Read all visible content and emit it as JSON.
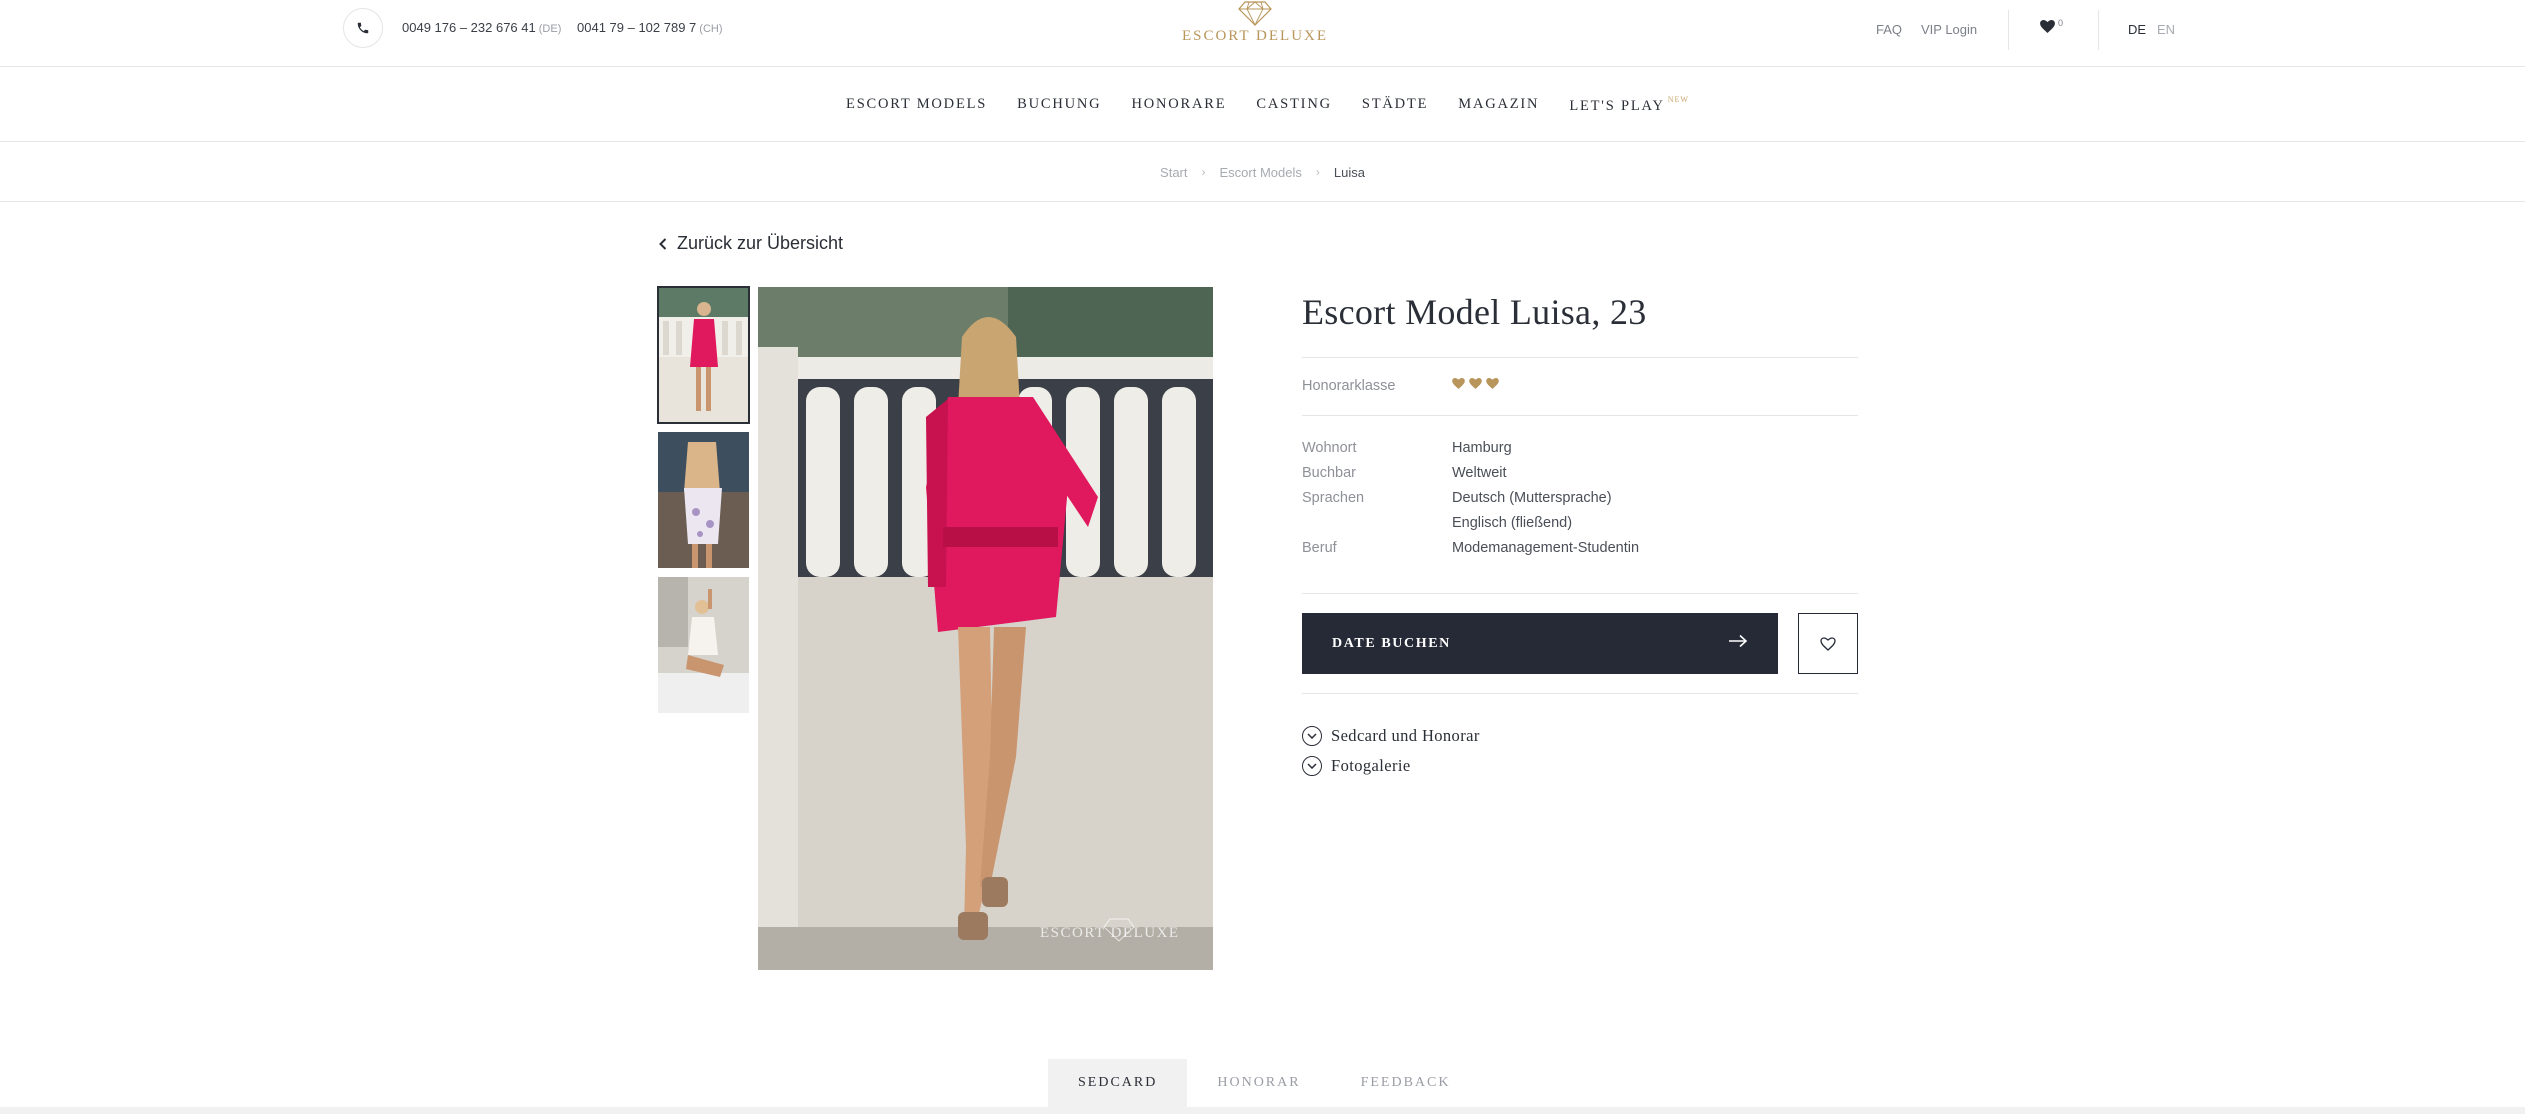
{
  "topbar": {
    "phone_de": "0049 176 – 232 676 41",
    "phone_de_cc": "(DE)",
    "phone_ch": "0041 79 – 102 789 7",
    "phone_ch_cc": "(CH)",
    "logo_text": "ESCORT DELUXE",
    "faq": "FAQ",
    "vip_login": "VIP Login",
    "favorites_count": "0",
    "lang_de": "DE",
    "lang_en": "EN",
    "accent_color": "#b8955a"
  },
  "nav": {
    "items": [
      "ESCORT MODELS",
      "BUCHUNG",
      "HONORARE",
      "CASTING",
      "STÄDTE",
      "MAGAZIN",
      "LET'S PLAY"
    ],
    "new_badge": "NEW"
  },
  "breadcrumb": [
    "Start",
    "Escort Models",
    "Luisa"
  ],
  "back_link": "Zurück zur Übersicht",
  "gallery": {
    "watermark": "ESCORT DELUXE"
  },
  "profile": {
    "title": "Escort Model Luisa, 23",
    "honorar_label": "Honorarklasse",
    "honorar_level": 3,
    "details": [
      {
        "label": "Wohnort",
        "value": "Hamburg"
      },
      {
        "label": "Buchbar",
        "value": "Weltweit"
      },
      {
        "label": "Sprachen",
        "value": "Deutsch (Muttersprache)"
      },
      {
        "label": "",
        "value": "Englisch (fließend)"
      },
      {
        "label": "Beruf",
        "value": "Modemanagement-Studentin"
      }
    ],
    "book_button": "DATE BUCHEN",
    "accordions": [
      "Sedcard und Honorar",
      "Fotogalerie"
    ]
  },
  "tabs": [
    "SEDCARD",
    "HONORAR",
    "FEEDBACK"
  ]
}
